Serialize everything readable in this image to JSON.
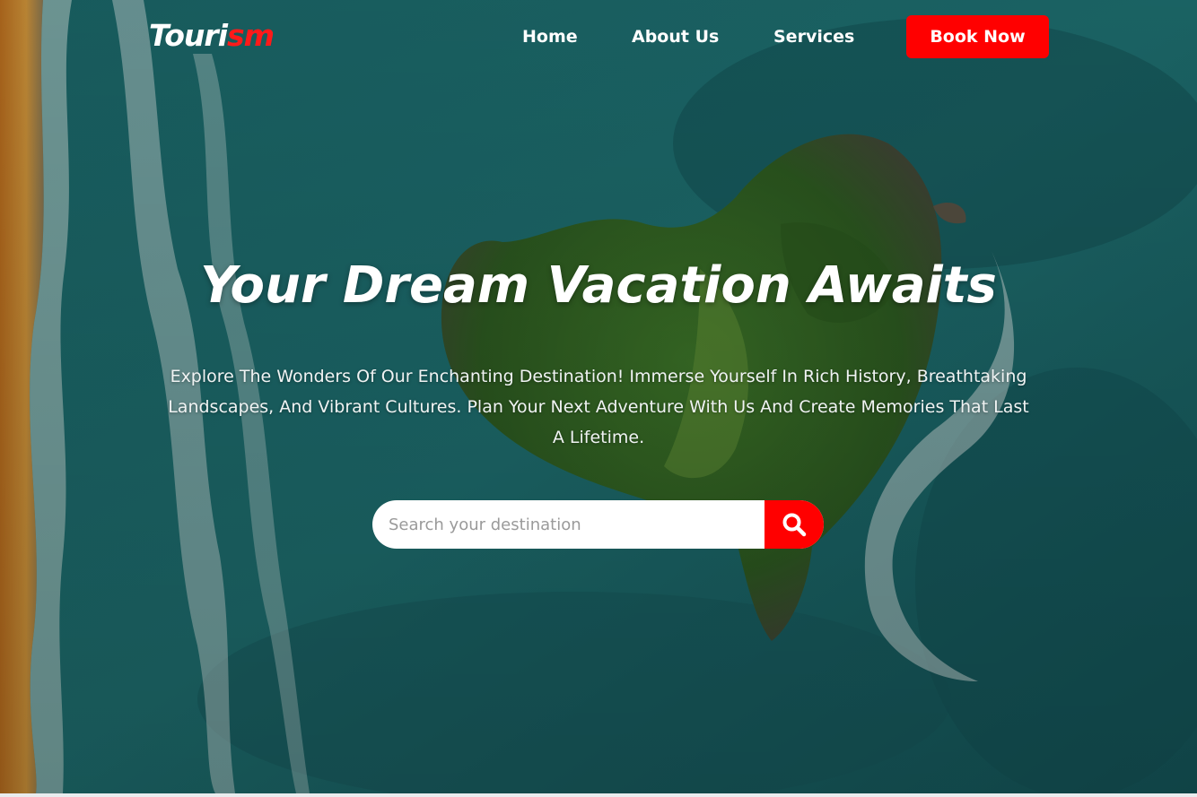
{
  "brand": {
    "logo_part1": "Touri",
    "logo_part2": "sm"
  },
  "nav": {
    "items": [
      {
        "label": "Home"
      },
      {
        "label": "About Us"
      },
      {
        "label": "Services"
      }
    ],
    "cta_label": "Book Now"
  },
  "hero": {
    "headline": "Your Dream Vacation Awaits",
    "description": "Explore The Wonders Of Our Enchanting Destination! Immerse Yourself In Rich History, Breathtaking Landscapes, And Vibrant Cultures. Plan Your Next Adventure With Us And Create Memories That Last A Lifetime.",
    "search": {
      "placeholder": "Search your destination",
      "value": "",
      "button_icon": "search-icon"
    }
  },
  "colors": {
    "accent": "#ff0000",
    "text_light": "#ffffff",
    "ocean": "#1d6b6c"
  }
}
